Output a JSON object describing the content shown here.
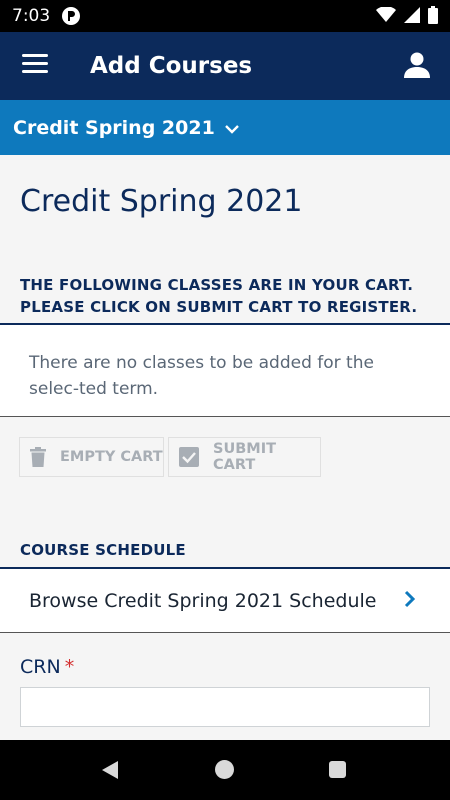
{
  "status_bar": {
    "time": "7:03",
    "app_icon": "p-icon"
  },
  "app_bar": {
    "title": "Add Courses",
    "menu_icon": "hamburger-menu-icon",
    "account_icon": "person-icon"
  },
  "term_selector": {
    "label": "Credit Spring 2021",
    "icon": "chevron-down-icon"
  },
  "page": {
    "title": "Credit Spring 2021"
  },
  "cart": {
    "heading": "THE FOLLOWING CLASSES ARE IN YOUR CART. PLEASE CLICK ON SUBMIT CART TO REGISTER.",
    "empty_message": "There are no classes to be added for the selec-ted term.",
    "empty_button_label": "EMPTY CART",
    "submit_button_label": "SUBMIT CART"
  },
  "schedule": {
    "heading": "COURSE SCHEDULE",
    "browse_label": "Browse Credit Spring 2021 Schedule"
  },
  "crn": {
    "label": "CRN",
    "required_mark": "*",
    "value": ""
  },
  "colors": {
    "app_bar": "#0c2a5b",
    "term_bar": "#0e79bd",
    "heading_text": "#0c2a5b",
    "required": "#d32f2f",
    "disabled_text": "#a8aeb5"
  }
}
